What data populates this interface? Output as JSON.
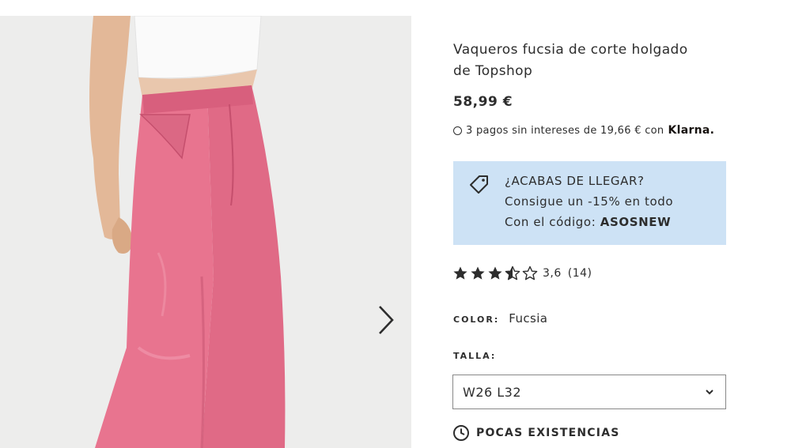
{
  "product": {
    "title_line1": "Vaqueros fucsia de corte holgado",
    "title_line2": "de Topshop",
    "price": "58,99 €",
    "klarna_text": "3 pagos sin intereses de 19,66 € con",
    "klarna_brand": "Klarna."
  },
  "promo": {
    "line1": "¿ACABAS DE LLEGAR?",
    "line2": "Consigue un -15% en todo",
    "line3_prefix": "Con el código: ",
    "code": "ASOSNEW",
    "icon": "tag-icon",
    "background": "#cde2f5"
  },
  "rating": {
    "stars_value": 3.6,
    "score": "3,6",
    "count": "(14)"
  },
  "color": {
    "label": "COLOR:",
    "value": "Fucsia",
    "product_color": "#e8748f"
  },
  "size": {
    "label": "TALLA:",
    "selected": "W26 L32"
  },
  "stock": {
    "label": "POCAS EXISTENCIAS",
    "icon": "clock-icon"
  },
  "gallery": {
    "next_icon": "chevron-right-icon"
  }
}
